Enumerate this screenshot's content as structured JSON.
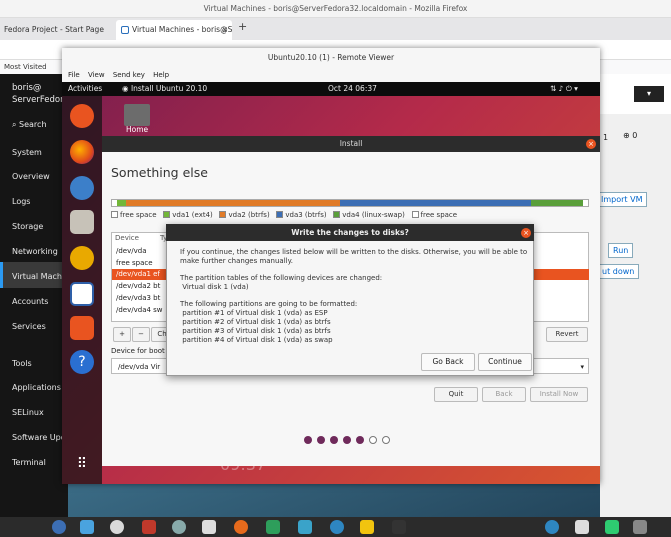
{
  "firefox": {
    "window_title": "Virtual Machines - boris@ServerFedora32.localdomain - Mozilla Firefox",
    "tabs": [
      "Fedora Project - Start Page",
      "Virtual Machines - boris@Ser"
    ],
    "new_tab": "+",
    "bookmark": "Most Visited"
  },
  "cockpit": {
    "user_line1": "boris@",
    "user_line2": "ServerFedora",
    "search": "Search",
    "nav": [
      "System",
      "Overview",
      "Logs",
      "Storage",
      "Networking",
      "Virtual Machin",
      "Accounts",
      "Services",
      "Tools",
      "Applications",
      "SELinux",
      "Software Upd",
      "Terminal"
    ],
    "import_vm": "Import VM",
    "run": "Run",
    "shut_down": "ut down",
    "stat1": "1",
    "stat2": "0"
  },
  "remote_viewer": {
    "title": "Ubuntu20.10 (1) - Remote Viewer",
    "menu": [
      "File",
      "View",
      "Send key",
      "Help"
    ]
  },
  "ubuntu": {
    "activities": "Activities",
    "app": "Install Ubuntu 20.10",
    "clock": "Oct 24  06:37",
    "home": "Home",
    "lock_clock": "09:37"
  },
  "install": {
    "window_title": "Install",
    "heading": "Something else",
    "legend": [
      {
        "label": "free space",
        "color": "#ffffff"
      },
      {
        "label": "vda1 (ext4)",
        "color": "#73b739"
      },
      {
        "label": "vda2 (btrfs)",
        "color": "#e07b28"
      },
      {
        "label": "vda3 (btrfs)",
        "color": "#3c6eb4"
      },
      {
        "label": "vda4 (linux-swap)",
        "color": "#5a9f3a"
      },
      {
        "label": "free space",
        "color": "#ffffff"
      }
    ],
    "col_device": "Device",
    "col_type": "Ty",
    "rows": [
      "/dev/vda",
      "free space",
      "/dev/vda1  ef",
      "/dev/vda2  bt",
      "/dev/vda3  bt",
      "/dev/vda4  sw"
    ],
    "revert": "Revert",
    "ch": "Ch",
    "boot_label": "Device for boot",
    "boot_value": "/dev/vda   Vir",
    "quit": "Quit",
    "back": "Back",
    "install_now": "Install Now"
  },
  "dialog": {
    "title": "Write the changes to disks?",
    "p1": "If you continue, the changes listed below will be written to the disks. Otherwise, you will be able to\nmake further changes manually.",
    "p2": "The partition tables of the following devices are changed:\n Virtual disk 1 (vda)",
    "p3": "The following partitions are going to be formatted:\n partition #1 of Virtual disk 1 (vda) as ESP\n partition #2 of Virtual disk 1 (vda) as btrfs\n partition #3 of Virtual disk 1 (vda) as btrfs\n partition #4 of Virtual disk 1 (vda) as swap",
    "go_back": "Go Back",
    "continue": "Continue"
  }
}
